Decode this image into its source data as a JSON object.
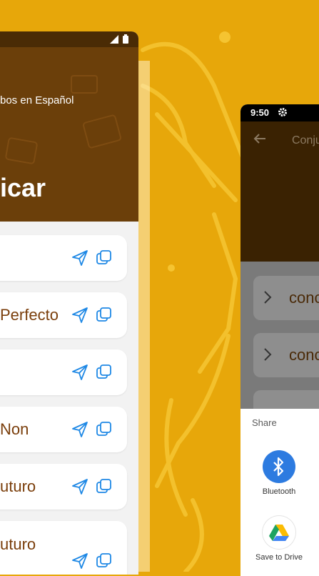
{
  "left_phone": {
    "app_name": "bos en Español",
    "heading": "icar",
    "tenses": [
      {
        "label": ""
      },
      {
        "label": "Perfecto"
      },
      {
        "label": ""
      },
      {
        "label": "Non"
      },
      {
        "label": "uturo"
      },
      {
        "label": "uturo"
      }
    ],
    "card_icons": {
      "send": "send-icon",
      "copy": "copy-icon"
    }
  },
  "right_phone": {
    "time": "9:50",
    "title": "Conju",
    "items": [
      {
        "text": "conc"
      },
      {
        "text": "conc"
      }
    ],
    "share": {
      "title": "Share",
      "targets": [
        {
          "label": "Bluetooth",
          "icon": "bluetooth-icon"
        },
        {
          "label": "Save to Drive",
          "icon": "google-drive-icon"
        }
      ]
    }
  },
  "colors": {
    "background": "#E7A70A",
    "header_brown": "#6B3F0A",
    "tense_text": "#7A3E0B",
    "icon_blue": "#1E88E5"
  }
}
